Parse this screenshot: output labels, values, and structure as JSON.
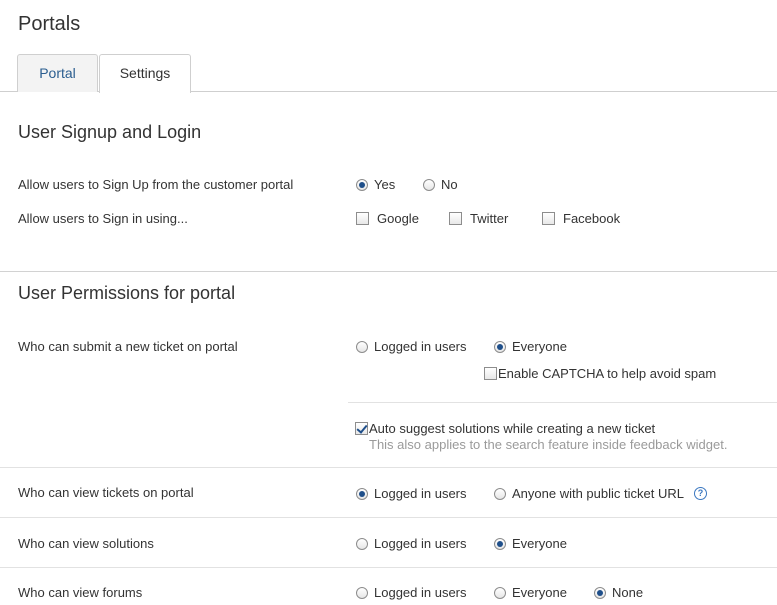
{
  "page": {
    "title": "Portals"
  },
  "tabs": [
    {
      "label": "Portal",
      "active": false
    },
    {
      "label": "Settings",
      "active": true
    }
  ],
  "signup": {
    "title": "User Signup and Login",
    "allow_signup": {
      "label": "Allow users to Sign Up from the customer portal",
      "options": [
        "Yes",
        "No"
      ],
      "selected": "Yes"
    },
    "sign_in": {
      "label": "Allow users to Sign in using...",
      "options": [
        {
          "label": "Google",
          "checked": false
        },
        {
          "label": "Twitter",
          "checked": false
        },
        {
          "label": "Facebook",
          "checked": false
        }
      ]
    }
  },
  "permissions": {
    "title": "User Permissions for portal",
    "submit_ticket": {
      "label": "Who can submit a new ticket on portal",
      "options": [
        "Logged in users",
        "Everyone"
      ],
      "selected": "Everyone",
      "captcha_label": "Enable CAPTCHA to help avoid spam",
      "captcha_checked": false
    },
    "auto_suggest": {
      "label": "Auto suggest solutions while creating a new ticket",
      "hint": "This also applies to the search feature inside feedback widget.",
      "checked": true
    },
    "view_tickets": {
      "label": "Who can view tickets on portal",
      "options": [
        "Logged in users",
        "Anyone with public ticket URL"
      ],
      "selected": "Logged in users",
      "help_icon": "?"
    },
    "view_solutions": {
      "label": "Who can view solutions",
      "options": [
        "Logged in users",
        "Everyone"
      ],
      "selected": "Everyone"
    },
    "view_forums": {
      "label": "Who can view forums",
      "options": [
        "Logged in users",
        "Everyone",
        "None"
      ],
      "selected": "None"
    }
  },
  "colors": {
    "accent": "#1f4f8a",
    "link": "#2a5d8f",
    "border": "#cfcfcf",
    "hint": "#9a9a9a"
  }
}
